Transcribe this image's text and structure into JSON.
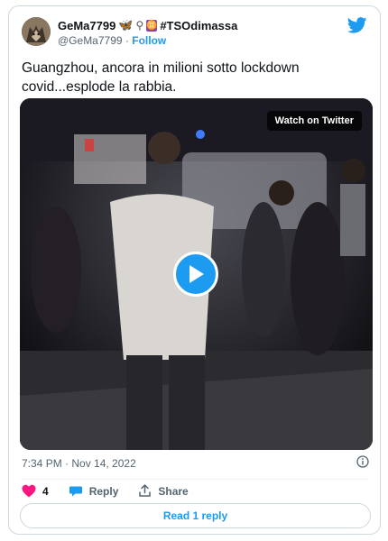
{
  "author": {
    "display_name": "GeMa7799",
    "emoji": "🦋",
    "hashtag": "#TSOdimassa",
    "handle": "@GeMa7799",
    "follow_label": "Follow"
  },
  "tweet": {
    "text": "Guangzhou, ancora in milioni sotto lockdown covid...esplode la rabbia.",
    "timestamp": "7:34 PM · Nov 14, 2022"
  },
  "media": {
    "watch_label": "Watch on Twitter"
  },
  "actions": {
    "like_count": "4",
    "reply_label": "Reply",
    "share_label": "Share"
  },
  "read_replies_label": "Read 1 reply",
  "colors": {
    "accent": "#1d9bf0",
    "like": "#f91880",
    "secondary_text": "#536471"
  }
}
